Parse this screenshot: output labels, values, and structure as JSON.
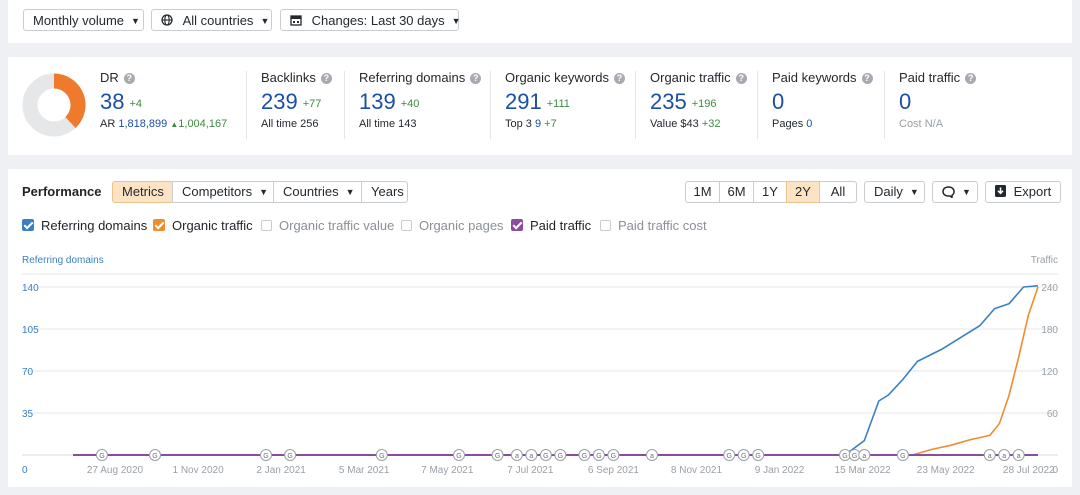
{
  "toolbar": {
    "volume": "Monthly volume",
    "countries": "All countries",
    "changes": "Changes: Last 30 days"
  },
  "overview": {
    "dr": {
      "label": "DR",
      "value": "38",
      "delta": "+4",
      "ar_label": "AR",
      "ar_value": "1,818,899",
      "ar_delta": "1,004,167",
      "ring_fraction": 0.38
    },
    "backlinks": {
      "label": "Backlinks",
      "value": "239",
      "delta": "+77",
      "sub_label": "All time",
      "sub_value": "256"
    },
    "referring_domains": {
      "label": "Referring domains",
      "value": "139",
      "delta": "+40",
      "sub_label": "All time",
      "sub_value": "143"
    },
    "organic_keywords": {
      "label": "Organic keywords",
      "value": "291",
      "delta": "+111",
      "sub_label": "Top 3",
      "sub_value": "9",
      "sub_delta": "+7"
    },
    "organic_traffic": {
      "label": "Organic traffic",
      "value": "235",
      "delta": "+196",
      "sub_label": "Value",
      "sub_value": "$43",
      "sub_delta": "+32"
    },
    "paid_keywords": {
      "label": "Paid keywords",
      "value": "0",
      "sub_label": "Pages",
      "sub_value": "0"
    },
    "paid_traffic": {
      "label": "Paid traffic",
      "value": "0",
      "sub_label": "Cost",
      "sub_value": "N/A"
    }
  },
  "performance": {
    "title": "Performance",
    "tabs": [
      "Metrics",
      "Competitors",
      "Countries",
      "Years"
    ],
    "ranges": [
      "1M",
      "6M",
      "1Y",
      "2Y",
      "All"
    ],
    "active_range": "2Y",
    "interval": "Daily",
    "export": "Export",
    "checkboxes": [
      {
        "label": "Referring domains",
        "checked": true,
        "color": "#3a7fc4"
      },
      {
        "label": "Organic traffic",
        "checked": true,
        "color": "#ef8c2e"
      },
      {
        "label": "Organic traffic value",
        "checked": false
      },
      {
        "label": "Organic pages",
        "checked": false
      },
      {
        "label": "Paid traffic",
        "checked": true,
        "color": "#8a4c9e"
      },
      {
        "label": "Paid traffic cost",
        "checked": false
      }
    ]
  },
  "chart_data": {
    "type": "line",
    "left_axis_label": "Referring domains",
    "right_axis_label": "Traffic",
    "left_ticks": [
      0,
      35,
      70,
      105,
      140
    ],
    "right_ticks": [
      0,
      60,
      120,
      180,
      240
    ],
    "ylim_left": [
      0,
      140
    ],
    "ylim_right": [
      0,
      240
    ],
    "x_tick_labels": [
      "27 Aug 2020",
      "1 Nov 2020",
      "2 Jan 2021",
      "5 Mar 2021",
      "7 May 2021",
      "7 Jul 2021",
      "6 Sep 2021",
      "8 Nov 2021",
      "9 Jan 2022",
      "15 Mar 2022",
      "23 May 2022",
      "28 Jul 2022"
    ],
    "grid": true,
    "series": [
      {
        "name": "Referring domains",
        "axis": "left",
        "color": "#3a7fc4",
        "x": [
          0,
          0.8,
          0.82,
          0.835,
          0.845,
          0.86,
          0.875,
          0.9,
          0.92,
          0.94,
          0.955,
          0.97,
          0.985,
          1.0
        ],
        "values": [
          0,
          0,
          12,
          45,
          50,
          63,
          78,
          88,
          98,
          108,
          122,
          126,
          140,
          141
        ]
      },
      {
        "name": "Organic traffic",
        "axis": "right",
        "color": "#ef8c2e",
        "x": [
          0,
          0.87,
          0.89,
          0.91,
          0.93,
          0.95,
          0.96,
          0.97,
          0.98,
          0.99,
          1.0
        ],
        "values": [
          0,
          0,
          8,
          14,
          22,
          28,
          45,
          85,
          140,
          200,
          240
        ]
      },
      {
        "name": "Paid traffic",
        "axis": "right",
        "color": "#8a4c9e",
        "x": [
          0,
          1.0
        ],
        "values": [
          0,
          0
        ]
      }
    ],
    "annotation_markers": [
      "G",
      "G",
      "G",
      "G",
      "G",
      "G",
      "G",
      "a",
      "a",
      "G",
      "G",
      "G",
      "G",
      "G",
      "a",
      "G",
      "G",
      "G",
      "G",
      "G",
      "a",
      "G",
      "a",
      "a",
      "a"
    ],
    "annotation_marker_x": [
      0.03,
      0.085,
      0.2,
      0.225,
      0.32,
      0.4,
      0.44,
      0.46,
      0.475,
      0.49,
      0.505,
      0.53,
      0.545,
      0.56,
      0.6,
      0.68,
      0.695,
      0.71,
      0.8,
      0.81,
      0.82,
      0.86,
      0.95,
      0.965,
      0.98
    ]
  }
}
